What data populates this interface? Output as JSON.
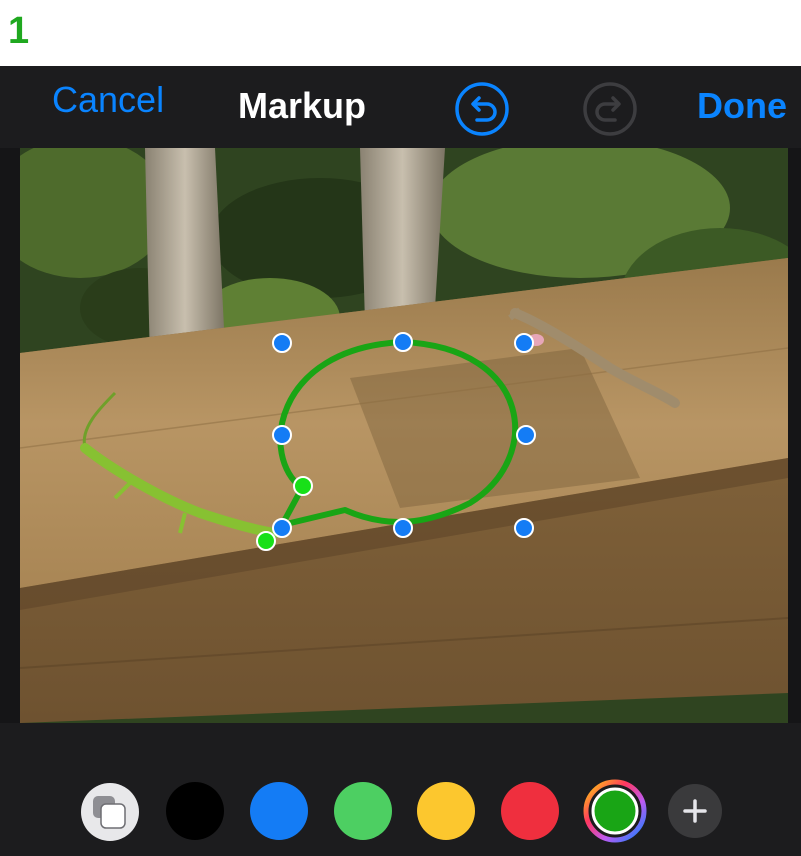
{
  "step": {
    "number": "1"
  },
  "nav": {
    "cancel_label": "Cancel",
    "title": "Markup",
    "done_label": "Done",
    "undo_icon": "undo-icon",
    "redo_icon": "redo-icon"
  },
  "annotation": {
    "shape": "speech-bubble",
    "stroke_color": "#19a515"
  },
  "palette": {
    "colors": [
      {
        "name": "black",
        "hex": "#000000"
      },
      {
        "name": "blue",
        "hex": "#147cf5"
      },
      {
        "name": "green",
        "hex": "#4dcf62"
      },
      {
        "name": "yellow",
        "hex": "#fcc72e"
      },
      {
        "name": "red",
        "hex": "#ef2f3e"
      }
    ],
    "selected_color": "#19a515",
    "accent": "#0a84ff"
  }
}
